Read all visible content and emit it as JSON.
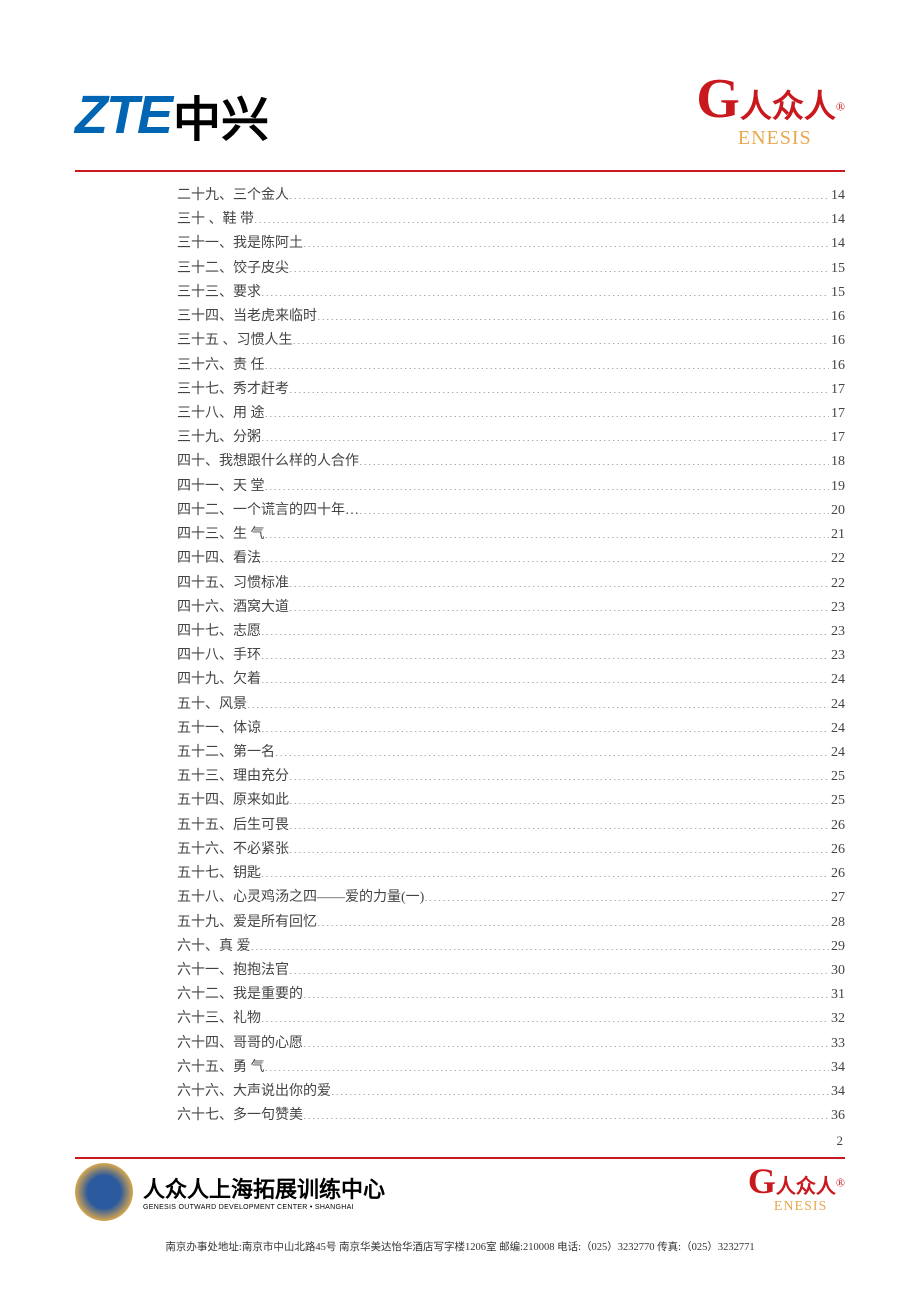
{
  "header": {
    "logo_zte_en": "ZTE",
    "logo_zte_cn": "中兴",
    "genesis_cn": "人众人",
    "genesis_r": "®",
    "genesis_g": "G",
    "genesis_rest": "ENESIS"
  },
  "toc": [
    {
      "num": "二十九、",
      "title": "三个金人",
      "page": "14"
    },
    {
      "num": "三十 、 ",
      "title": "鞋 带",
      "page": "14"
    },
    {
      "num": "三十一、",
      "title": "我是陈阿土",
      "page": "14"
    },
    {
      "num": "三十二、",
      "title": "饺子皮尖",
      "page": "15"
    },
    {
      "num": "三十三、",
      "title": "要求",
      "page": "15"
    },
    {
      "num": "三十四、",
      "title": "当老虎来临时",
      "page": "16"
    },
    {
      "num": "三十五 、",
      "title": "习惯人生",
      "page": "16"
    },
    {
      "num": "三十六、",
      "title": "责 任",
      "page": "16"
    },
    {
      "num": "三十七、",
      "title": "秀才赶考",
      "page": "17"
    },
    {
      "num": "三十八、",
      "title": "用 途",
      "page": "17"
    },
    {
      "num": "三十九、",
      "title": "分粥",
      "page": "17"
    },
    {
      "num": "四十、  ",
      "title": "我想跟什么样的人合作",
      "page": "18"
    },
    {
      "num": "四十一、",
      "title": "天  堂",
      "page": "19"
    },
    {
      "num": "四十二、",
      "title": "一个谎言的四十年…",
      "page": "20"
    },
    {
      "num": "四十三、",
      "title": "生   气",
      "page": "21"
    },
    {
      "num": "四十四、",
      "title": "看法",
      "page": "22"
    },
    {
      "num": "四十五、",
      "title": "习惯标准",
      "page": "22"
    },
    {
      "num": "四十六、",
      "title": "酒窝大道",
      "page": "23"
    },
    {
      "num": "四十七、",
      "title": "志愿",
      "page": "23"
    },
    {
      "num": "四十八、",
      "title": "手环",
      "page": "23"
    },
    {
      "num": "四十九、",
      "title": "欠着",
      "page": "24"
    },
    {
      "num": "五十、  ",
      "title": "风景",
      "page": "24"
    },
    {
      "num": "五十一、",
      "title": "体谅",
      "page": "24"
    },
    {
      "num": "五十二、",
      "title": "第一名",
      "page": "24"
    },
    {
      "num": "五十三、",
      "title": "理由充分",
      "page": "25"
    },
    {
      "num": "五十四、",
      "title": "原来如此",
      "page": "25"
    },
    {
      "num": "五十五、",
      "title": "后生可畏",
      "page": "26"
    },
    {
      "num": "五十六、",
      "title": "不必紧张",
      "page": "26"
    },
    {
      "num": "五十七、",
      "title": "钥匙",
      "page": "26"
    },
    {
      "num": "五十八、",
      "title": "心灵鸡汤之四——爱的力量(一)",
      "page": "27"
    },
    {
      "num": "五十九、",
      "title": "爱是所有回忆",
      "page": "28"
    },
    {
      "num": "六十、  ",
      "title": "真  爱",
      "page": "29"
    },
    {
      "num": "六十一、",
      "title": "抱抱法官",
      "page": "30"
    },
    {
      "num": "六十二、",
      "title": "我是重要的",
      "page": "31"
    },
    {
      "num": "六十三、",
      "title": "礼物",
      "page": "32"
    },
    {
      "num": "六十四、",
      "title": "哥哥的心愿",
      "page": "33"
    },
    {
      "num": "六十五、",
      "title": "勇   气",
      "page": "34"
    },
    {
      "num": "六十六、",
      "title": "大声说出你的爱",
      "page": "34"
    },
    {
      "num": "六十七、",
      "title": "多一句赞美",
      "page": "36"
    }
  ],
  "page_number": "2",
  "footer": {
    "cn_title": "人众人上海拓展训练中心",
    "en_title": "GENESIS OUTWARD DEVELOPMENT CENTER • SHANGHAI",
    "address": "南京办事处地址:南京市中山北路45号 南京华美达怡华酒店写字楼1206室 邮编:210008 电话:（025）3232770 传真:（025）3232771"
  }
}
